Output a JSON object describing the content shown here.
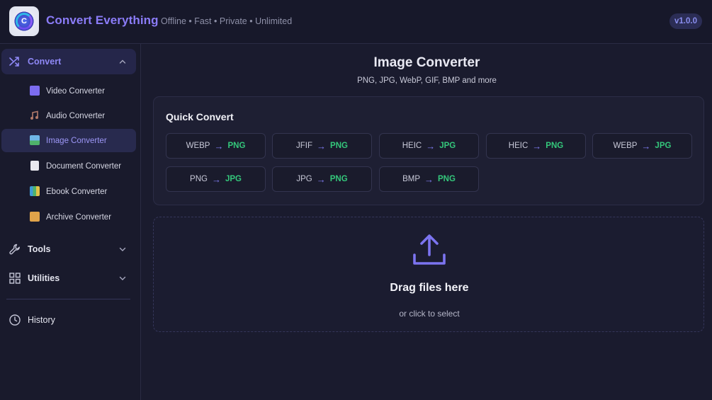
{
  "header": {
    "app_title": "Convert Everything",
    "tagline": "Offline • Fast • Private • Unlimited",
    "version": "v1.0.0",
    "logo_icon": "app-logo-icon"
  },
  "sidebar": {
    "convert": {
      "label": "Convert",
      "icon": "shuffle-icon",
      "expanded": true
    },
    "items": [
      {
        "label": "Video Converter",
        "icon": "clapper-icon",
        "color": "#7c6cf0"
      },
      {
        "label": "Audio Converter",
        "icon": "music-note-icon",
        "color": "#b27a6a"
      },
      {
        "label": "Image Converter",
        "icon": "picture-icon",
        "color": "#4fb36b",
        "selected": true
      },
      {
        "label": "Document Converter",
        "icon": "document-icon",
        "color": "#e8e8ef"
      },
      {
        "label": "Ebook Converter",
        "icon": "books-icon",
        "color": "#3f9bd6"
      },
      {
        "label": "Archive Converter",
        "icon": "package-icon",
        "color": "#e0a34a"
      }
    ],
    "tools": {
      "label": "Tools",
      "icon": "wrench-icon",
      "expanded": false
    },
    "utilities": {
      "label": "Utilities",
      "icon": "grid-icon",
      "expanded": false
    },
    "history": {
      "label": "History",
      "icon": "clock-icon"
    }
  },
  "main": {
    "title": "Image Converter",
    "subtitle": "PNG, JPG, WebP, GIF, BMP and more",
    "quick_convert": {
      "title": "Quick Convert",
      "arrow": "→",
      "buttons": [
        {
          "from": "WEBP",
          "to": "PNG"
        },
        {
          "from": "JFIF",
          "to": "PNG"
        },
        {
          "from": "HEIC",
          "to": "JPG"
        },
        {
          "from": "HEIC",
          "to": "PNG"
        },
        {
          "from": "WEBP",
          "to": "JPG"
        },
        {
          "from": "PNG",
          "to": "JPG"
        },
        {
          "from": "JPG",
          "to": "PNG"
        },
        {
          "from": "BMP",
          "to": "PNG"
        }
      ]
    },
    "dropzone": {
      "title": "Drag files here",
      "subtitle": "or click to select",
      "icon": "upload-icon"
    }
  },
  "colors": {
    "accent": "#8b7cf8",
    "target_format": "#34c77b",
    "background": "#1a1b2e"
  }
}
